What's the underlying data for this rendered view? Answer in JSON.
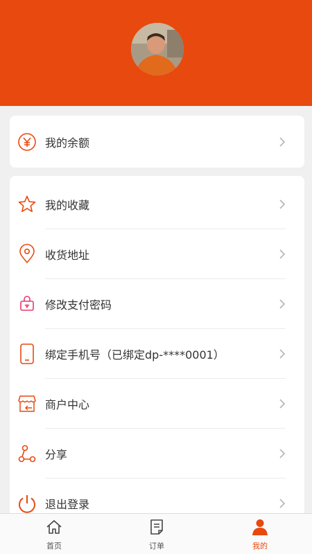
{
  "colors": {
    "accent": "#e8490f",
    "text": "#333333",
    "chevron": "#b5b5b5"
  },
  "balance": {
    "label": "我的余额",
    "icon": "yuan-circle-icon"
  },
  "menu": {
    "items": [
      {
        "label": "我的收藏",
        "icon": "star-icon"
      },
      {
        "label": "收货地址",
        "icon": "location-pin-icon"
      },
      {
        "label": "修改支付密码",
        "icon": "lock-bag-icon"
      },
      {
        "label": "绑定手机号（已绑定dp-****0001）",
        "icon": "phone-icon"
      },
      {
        "label": "商户中心",
        "icon": "storefront-icon"
      },
      {
        "label": "分享",
        "icon": "share-icon"
      },
      {
        "label": "退出登录",
        "icon": "power-icon"
      }
    ]
  },
  "tabbar": {
    "tabs": [
      {
        "label": "首页",
        "icon": "home-icon",
        "active": false
      },
      {
        "label": "订单",
        "icon": "order-list-icon",
        "active": false
      },
      {
        "label": "我的",
        "icon": "user-icon",
        "active": true
      }
    ]
  }
}
